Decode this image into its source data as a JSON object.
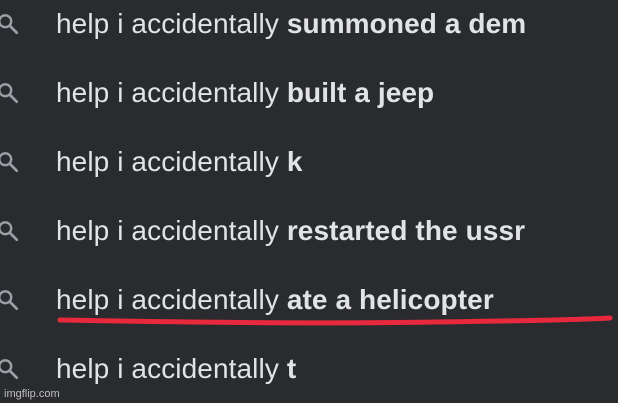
{
  "suggestions": [
    {
      "icon": "search-icon",
      "prefix": "help i accidentally ",
      "completion": "summoned a dem"
    },
    {
      "icon": "search-icon",
      "prefix": "help i accidentally ",
      "completion": "built a jeep"
    },
    {
      "icon": "search-icon",
      "prefix": "help i accidentally ",
      "completion": "k"
    },
    {
      "icon": "search-icon",
      "prefix": "help i accidentally ",
      "completion": "restarted the ussr"
    },
    {
      "icon": "search-icon",
      "prefix": "help i accidentally ",
      "completion": "ate a helicopter"
    },
    {
      "icon": "search-icon",
      "prefix": "help i accidentally ",
      "completion": "t"
    }
  ],
  "colors": {
    "background": "#2a2b2e",
    "text": "#e2e3e6",
    "icon": "#9aa0a6",
    "underline": "#e8283c"
  },
  "watermark": "imgflip.com"
}
